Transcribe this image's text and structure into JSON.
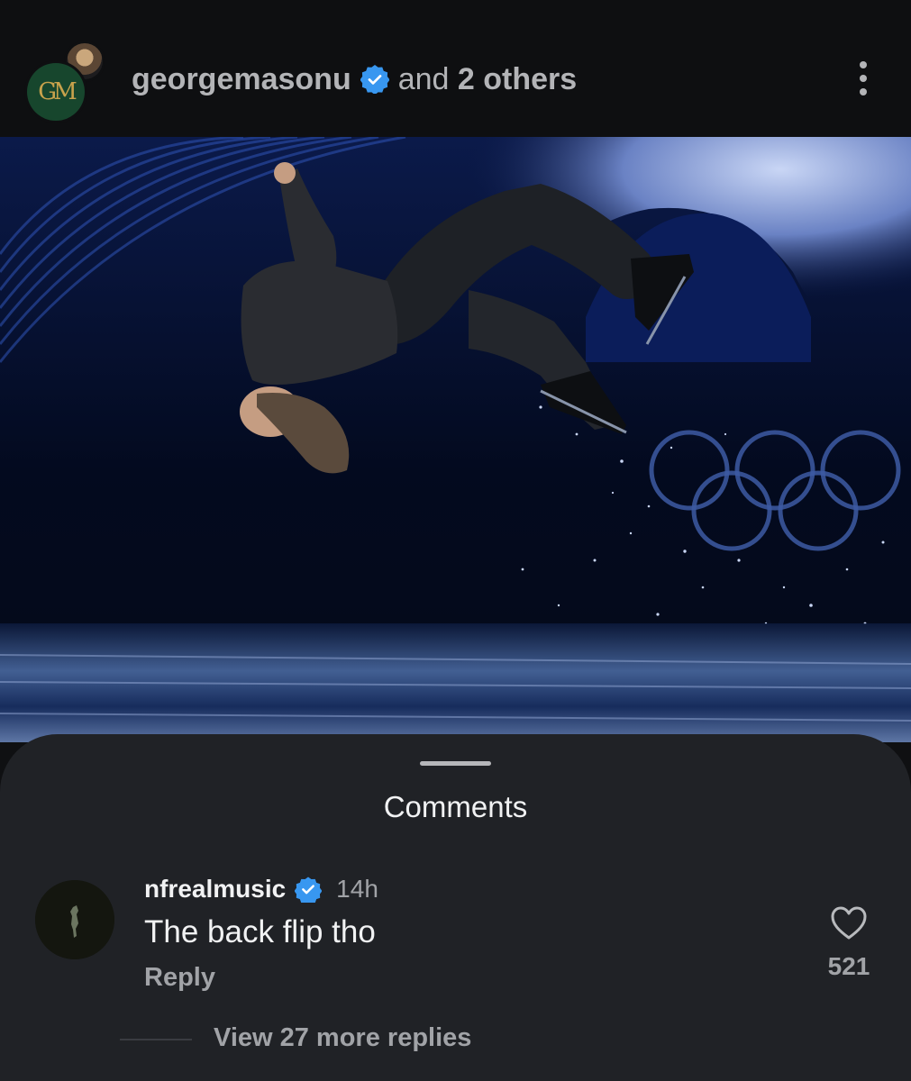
{
  "header": {
    "avatar_initials": "GM",
    "username": "georgemasonu",
    "others_prefix": "and",
    "others_count": "2 others",
    "more_icon": "more-vertical-icon",
    "verified_icon": "verified-badge-icon"
  },
  "post": {
    "image_subject": "figure skater backflip on Olympic ice"
  },
  "comments": {
    "title": "Comments",
    "items": [
      {
        "username": "nfrealmusic",
        "verified": true,
        "time": "14h",
        "text": "The back flip tho",
        "reply_label": "Reply",
        "like_count": "521",
        "like_icon": "heart-icon",
        "view_replies_label": "View 27 more replies"
      }
    ]
  },
  "colors": {
    "background": "#0f1012",
    "sheet": "#202226",
    "verified_blue": "#3897f0",
    "muted_text": "#a1a3a7",
    "primary_text": "#f1f2f3",
    "avatar_green": "#17462d",
    "avatar_gold": "#c8a24c"
  }
}
